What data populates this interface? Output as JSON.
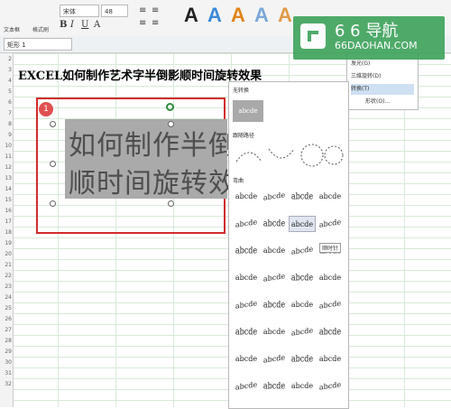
{
  "ribbon": {
    "text_box_label": "文本框",
    "format_brush_label": "格式刷",
    "font_name": "宋体",
    "font_size": "48",
    "gallery_letter": "A",
    "gallery_colors": [
      "#222222",
      "#3b8ad9",
      "#e0841a",
      "#7aa7d9",
      "#e09a4a"
    ]
  },
  "namebar": {
    "shape_name": "矩形 1"
  },
  "title": "EXCEL如何制作艺术字半倒影顺时间旋转效果",
  "badge": "1",
  "wordart": {
    "line1": "如何制作半倒",
    "line2": "顺时间旋转效"
  },
  "rows": [
    "2",
    "3",
    "4",
    "5",
    "6",
    "7",
    "8",
    "9",
    "10",
    "11",
    "12",
    "13",
    "14",
    "15",
    "16",
    "17",
    "18",
    "19",
    "20",
    "21",
    "22",
    "23",
    "24",
    "25",
    "26",
    "27",
    "28",
    "29",
    "30",
    "31",
    "32"
  ],
  "panel": {
    "no_transform": "无转换",
    "no_transform_sample": "abcde",
    "follow_path": "跟随路径",
    "warp": "弯曲",
    "tooltip": "顺时针",
    "warp_grid": [
      [
        "abcde",
        "abcde",
        "abcde",
        "abcde"
      ],
      [
        "abcde",
        "abcde",
        "abcde",
        "abcde"
      ],
      [
        "abcde",
        "abcde",
        "abcde",
        "abcde"
      ],
      [
        "abcde",
        "abcde",
        "abcde",
        "abcde"
      ],
      [
        "abcde",
        "abcde",
        "abcde",
        "abcde"
      ],
      [
        "abcde",
        "abcde",
        "abcde",
        "abcde"
      ],
      [
        "abcde",
        "abcde",
        "abcde",
        "abcde"
      ],
      [
        "abcde",
        "abcde",
        "abcde",
        "abcde"
      ]
    ]
  },
  "submenu": {
    "items": [
      "发光(G)",
      "三维旋转(D)",
      "转换(T)",
      "形状(O)..."
    ]
  },
  "watermark": {
    "line1": "6 6 导航",
    "line2": "66DAOHAN.COM"
  }
}
